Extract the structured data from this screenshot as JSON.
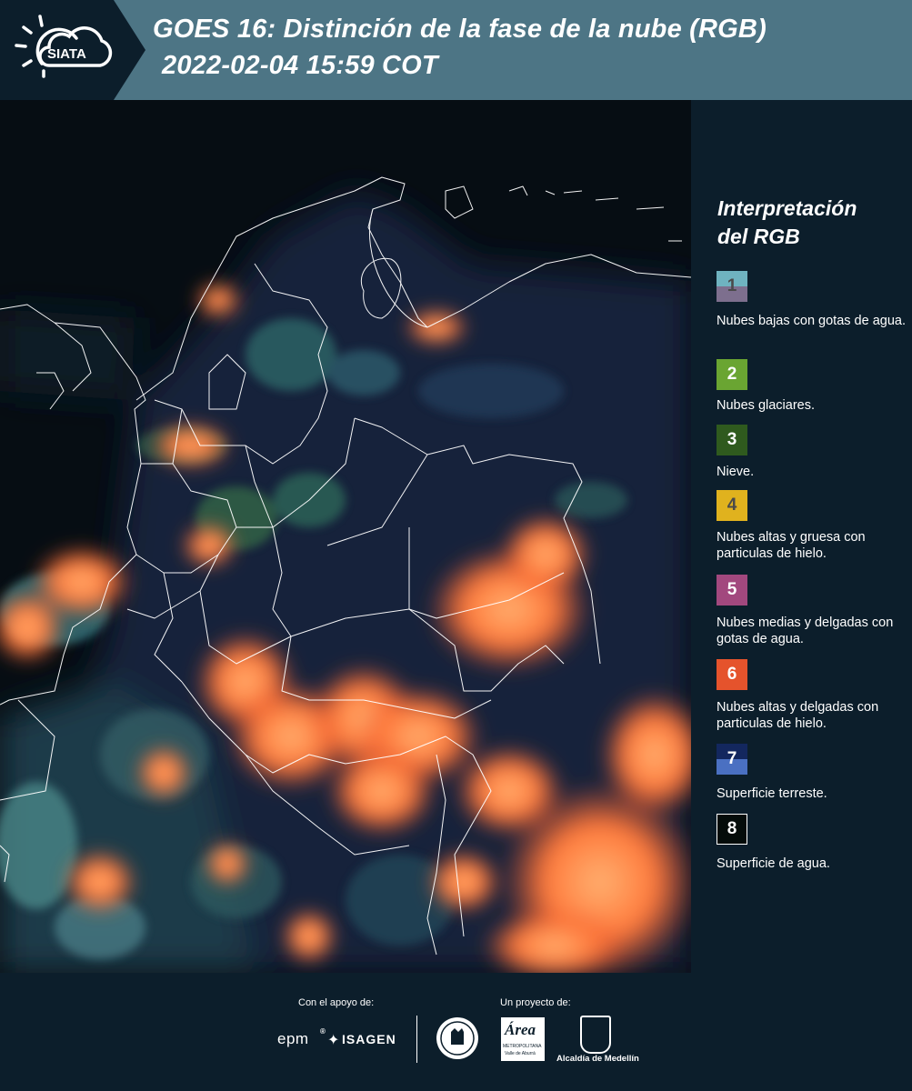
{
  "header": {
    "logo_text": "SIATA",
    "title_line1": "GOES 16: Distinción de la fase de la nube (RGB)",
    "title_line2": "2022-02-04 15:59 COT"
  },
  "legend": {
    "title_line1": "Interpretación",
    "title_line2": "del RGB",
    "items": [
      {
        "number": "1",
        "label": "Nubes bajas con gotas de agua.",
        "color_top": "#6fb3c0",
        "color_bottom": "#7d6f8e",
        "num_color": "#4a4a4a"
      },
      {
        "number": "2",
        "label": "Nubes glaciares.",
        "color_top": "#6aa532",
        "color_bottom": "#6aa532",
        "num_color": "#ffffff"
      },
      {
        "number": "3",
        "label": "Nieve.",
        "color_top": "#2f5a1e",
        "color_bottom": "#2f5a1e",
        "num_color": "#ffffff"
      },
      {
        "number": "4",
        "label": "Nubes altas y gruesa con particulas de hielo.",
        "color_top": "#e0b21e",
        "color_bottom": "#e0b21e",
        "num_color": "#4a4a4a"
      },
      {
        "number": "5",
        "label": "Nubes medias y delgadas con gotas de agua.",
        "color_top": "#a2487e",
        "color_bottom": "#a2487e",
        "num_color": "#ffffff"
      },
      {
        "number": "6",
        "label": "Nubes altas y delgadas con particulas de hielo.",
        "color_top": "#e5532c",
        "color_bottom": "#e5532c",
        "num_color": "#ffffff"
      },
      {
        "number": "7",
        "label": "Superficie terreste.",
        "color_top": "#13275e",
        "color_bottom": "#4a70c2",
        "num_color": "#ffffff"
      },
      {
        "number": "8",
        "label": "Superficie de agua.",
        "color_top": "#050c0a",
        "color_bottom": "#050c0a",
        "num_color": "#ffffff"
      }
    ]
  },
  "footer": {
    "support_label": "Con el apoyo de:",
    "project_label": "Un proyecto de:",
    "sponsor_epm": "epm",
    "sponsor_isagen": "ISAGEN",
    "area_name": "Área",
    "area_sub1": "METROPOLITANA",
    "area_sub2": "Valle de Aburrá",
    "alcaldia": "Alcaldía de Medellín"
  }
}
